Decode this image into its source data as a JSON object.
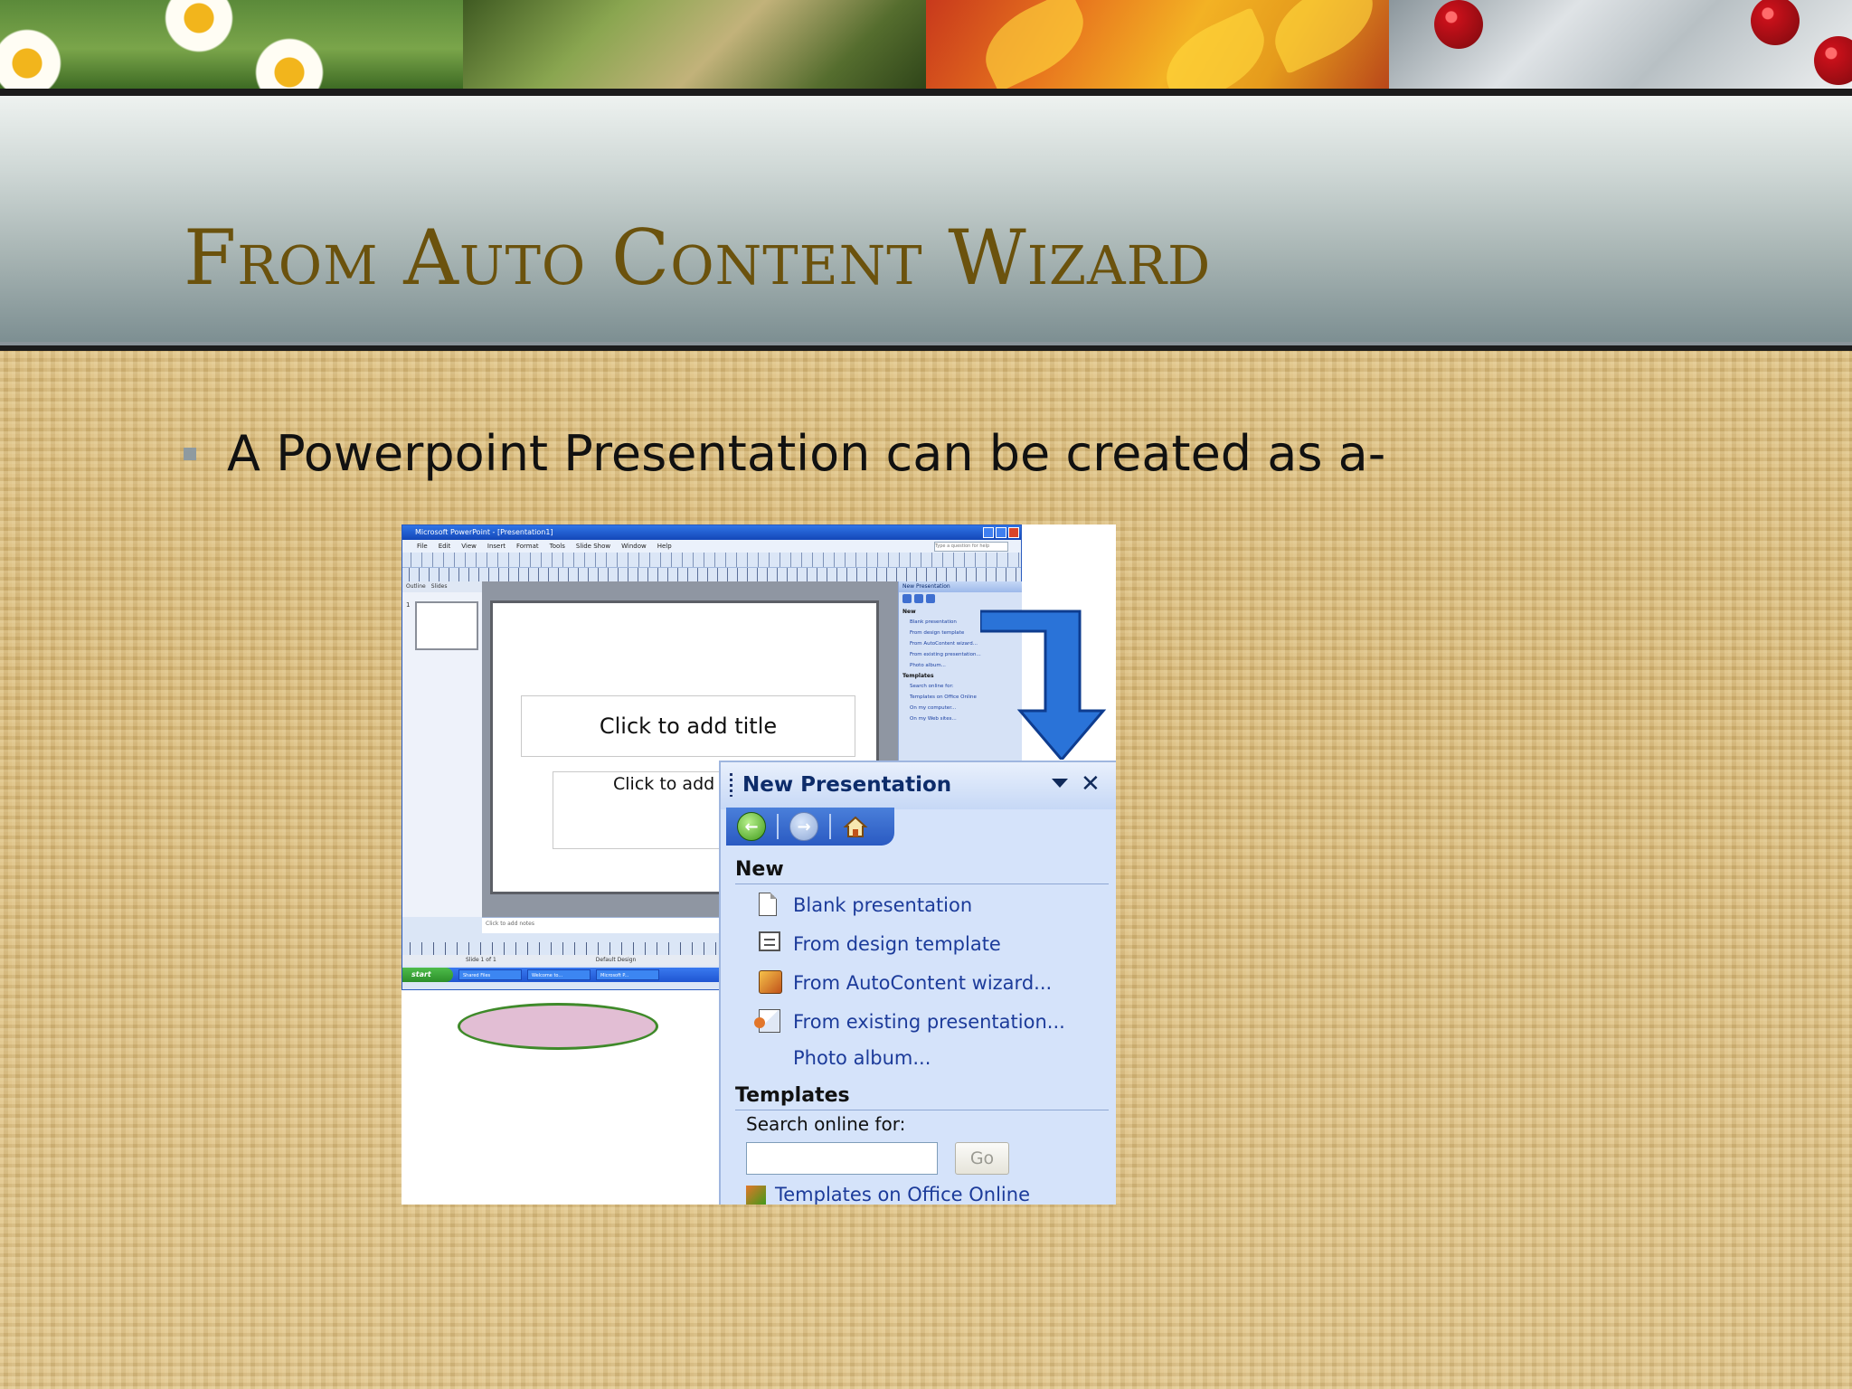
{
  "slide": {
    "title": "From Auto Content Wizard",
    "bullet": "A Powerpoint Presentation can be created as a-"
  },
  "ppt_window": {
    "title": "Microsoft PowerPoint - [Presentation1]",
    "menu": [
      "File",
      "Edit",
      "View",
      "Insert",
      "Format",
      "Tools",
      "Slide Show",
      "Window",
      "Help"
    ],
    "ask_placeholder": "Type a question for help",
    "thumb_tabs": [
      "Outline",
      "Slides"
    ],
    "slide_number": "1",
    "placeholder_title": "Click to add title",
    "placeholder_subtitle": "Click to add s",
    "notes_placeholder": "Click to add notes",
    "status": [
      "Slide 1 of 1",
      "Default Design"
    ],
    "start_label": "start",
    "taskbar_items": [
      "Shared Files",
      "Welcome to...",
      "Microsoft P..."
    ],
    "small_taskpane": {
      "title": "New Presentation",
      "section_new": "New",
      "items": [
        "Blank presentation",
        "From design template",
        "From AutoContent wizard...",
        "From existing presentation...",
        "Photo album..."
      ],
      "section_templates": "Templates",
      "search_label": "Search online for:",
      "template_items": [
        "Templates on Office Online",
        "On my computer...",
        "On my Web sites..."
      ]
    }
  },
  "task_pane": {
    "title": "New Presentation",
    "section_new": "New",
    "items": [
      {
        "label": "Blank presentation",
        "icon": "blank-doc-icon"
      },
      {
        "label": "From design template",
        "icon": "design-template-icon"
      },
      {
        "label": "From AutoContent wizard...",
        "icon": "autocontent-wizard-icon",
        "highlighted": true
      },
      {
        "label": "From existing presentation...",
        "icon": "existing-presentation-icon"
      },
      {
        "label": "Photo album...",
        "icon": ""
      }
    ],
    "section_templates": "Templates",
    "search_label": "Search online for:",
    "search_value": "",
    "go_label": "Go",
    "online_item": "Templates on Office Online"
  },
  "colors": {
    "title": "#6b520d",
    "link": "#1c3b9a",
    "highlight": "#be6ea0",
    "arrow": "#2a73d8"
  }
}
